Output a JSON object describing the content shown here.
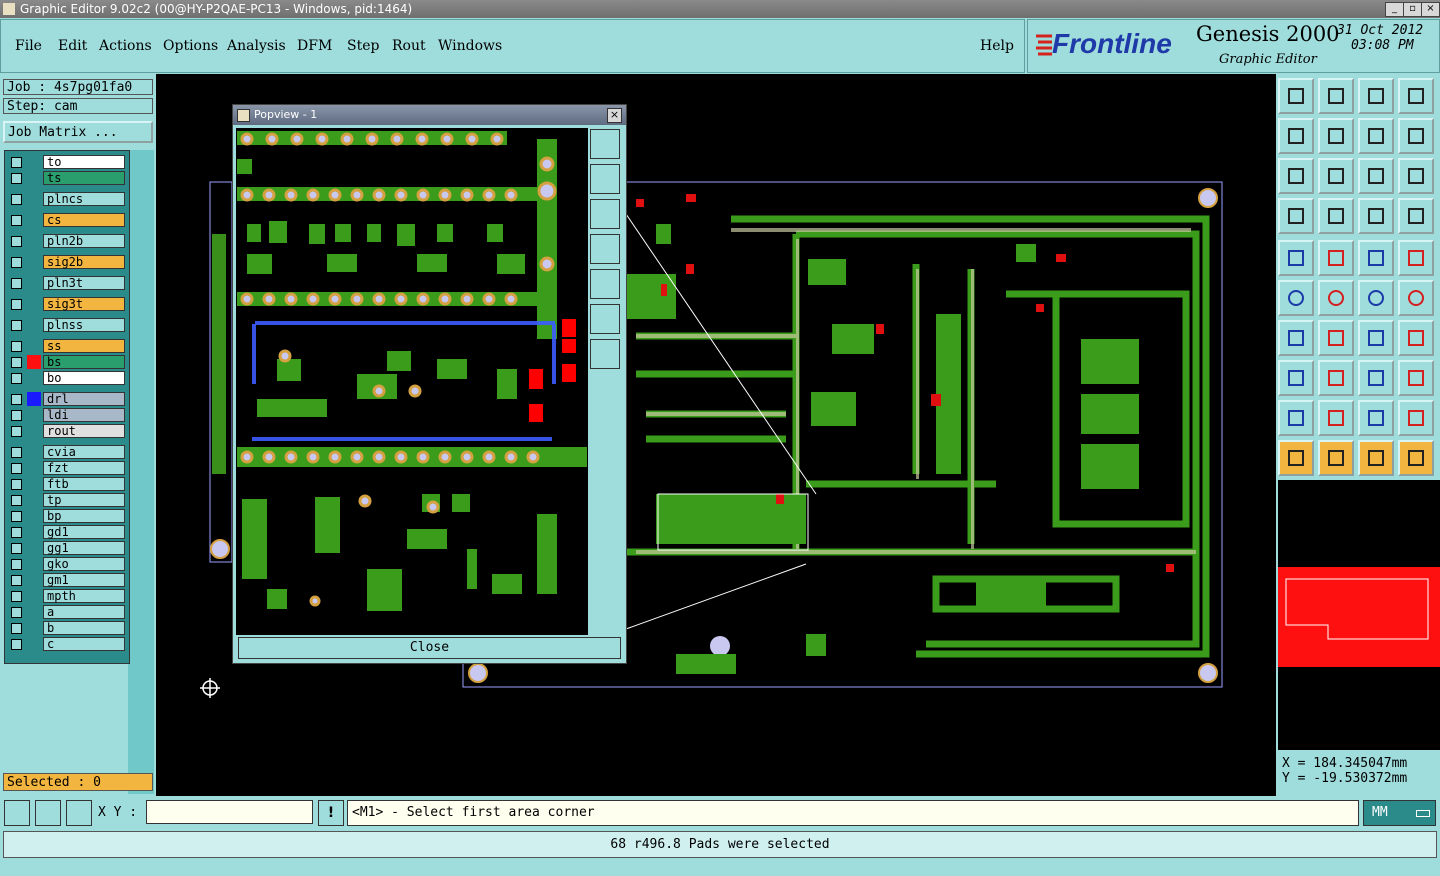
{
  "window": {
    "title": "Graphic Editor 9.02c2 (00@HY-P2QAE-PC13 - Windows, pid:1464)"
  },
  "menu": {
    "file": "File",
    "edit": "Edit",
    "actions": "Actions",
    "options": "Options",
    "analysis": "Analysis",
    "dfm": "DFM",
    "step": "Step",
    "rout": "Rout",
    "windows": "Windows",
    "help": "Help"
  },
  "brand": {
    "logo": "Frontline",
    "product": "Genesis 2000",
    "subtitle": "Graphic Editor",
    "date": "31 Oct 2012",
    "time": "03:08 PM"
  },
  "job": {
    "job_label": "Job : 4s7pg01fa0",
    "step_label": "Step: cam",
    "matrix_button": "Job Matrix ..."
  },
  "layers": [
    {
      "name": "to",
      "color": "#ffffff"
    },
    {
      "name": "ts",
      "color": "#2b9e6e"
    },
    {
      "name": "plncs",
      "color": "#9fdcdc"
    },
    {
      "name": "cs",
      "color": "#f2b640"
    },
    {
      "name": "pln2b",
      "color": "#9fdcdc"
    },
    {
      "name": "sig2b",
      "color": "#f2b640"
    },
    {
      "name": "pln3t",
      "color": "#9fdcdc"
    },
    {
      "name": "sig3t",
      "color": "#f2b640"
    },
    {
      "name": "plnss",
      "color": "#9fdcdc"
    },
    {
      "name": "ss",
      "color": "#f2b640"
    },
    {
      "name": "bs",
      "color": "#2b9e6e"
    },
    {
      "name": "bo",
      "color": "#ffffff"
    },
    {
      "name": "drl",
      "color": "#a8b8c8"
    },
    {
      "name": "ldi",
      "color": "#a8b8c8"
    },
    {
      "name": "rout",
      "color": "#e0e0e0"
    },
    {
      "name": "cvia",
      "color": "#9fdcdc"
    },
    {
      "name": "fzt",
      "color": "#9fdcdc"
    },
    {
      "name": "ftb",
      "color": "#9fdcdc"
    },
    {
      "name": "tp",
      "color": "#9fdcdc"
    },
    {
      "name": "bp",
      "color": "#9fdcdc"
    },
    {
      "name": "gd1",
      "color": "#9fdcdc"
    },
    {
      "name": "gg1",
      "color": "#9fdcdc"
    },
    {
      "name": "gko",
      "color": "#9fdcdc"
    },
    {
      "name": "gm1",
      "color": "#9fdcdc"
    },
    {
      "name": "mpth",
      "color": "#9fdcdc"
    },
    {
      "name": "a",
      "color": "#9fdcdc"
    },
    {
      "name": "b",
      "color": "#9fdcdc"
    },
    {
      "name": "c",
      "color": "#9fdcdc"
    }
  ],
  "selected": "Selected : 0",
  "popview": {
    "title": "Popview - 1",
    "close": "Close"
  },
  "coords": {
    "x": "X  =  184.345047mm",
    "y": "Y  = -19.530372mm"
  },
  "prompt": {
    "xy_label": "X Y :",
    "xy_value": "",
    "message": "<M1> - Select first area corner",
    "units": "MM"
  },
  "status": "68 r496.8 Pads were selected"
}
